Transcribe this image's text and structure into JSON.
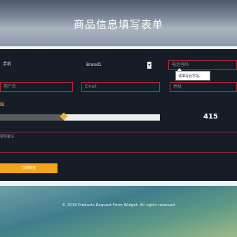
{
  "header": {
    "title": "商品信息填写表单"
  },
  "form": {
    "product_value": "手机",
    "brand_select": {
      "selected": "Brand1"
    },
    "phone_placeholder": "电话号码",
    "tooltip_text": "请填写此字段。",
    "name_placeholder": "用户名",
    "email_placeholder": "Email",
    "address_placeholder": "地址",
    "range_label": "围",
    "slider": {
      "value": "415",
      "fraction": 0.4
    },
    "notes_placeholder": "填写备注",
    "submit_label": "立即购买"
  },
  "footer": {
    "text": "© 2019 Products Request Form Widget. All rights reserved"
  },
  "colors": {
    "accent": "#f2a51a",
    "error_border": "#b02b3a",
    "panel_bg": "#171d26"
  }
}
